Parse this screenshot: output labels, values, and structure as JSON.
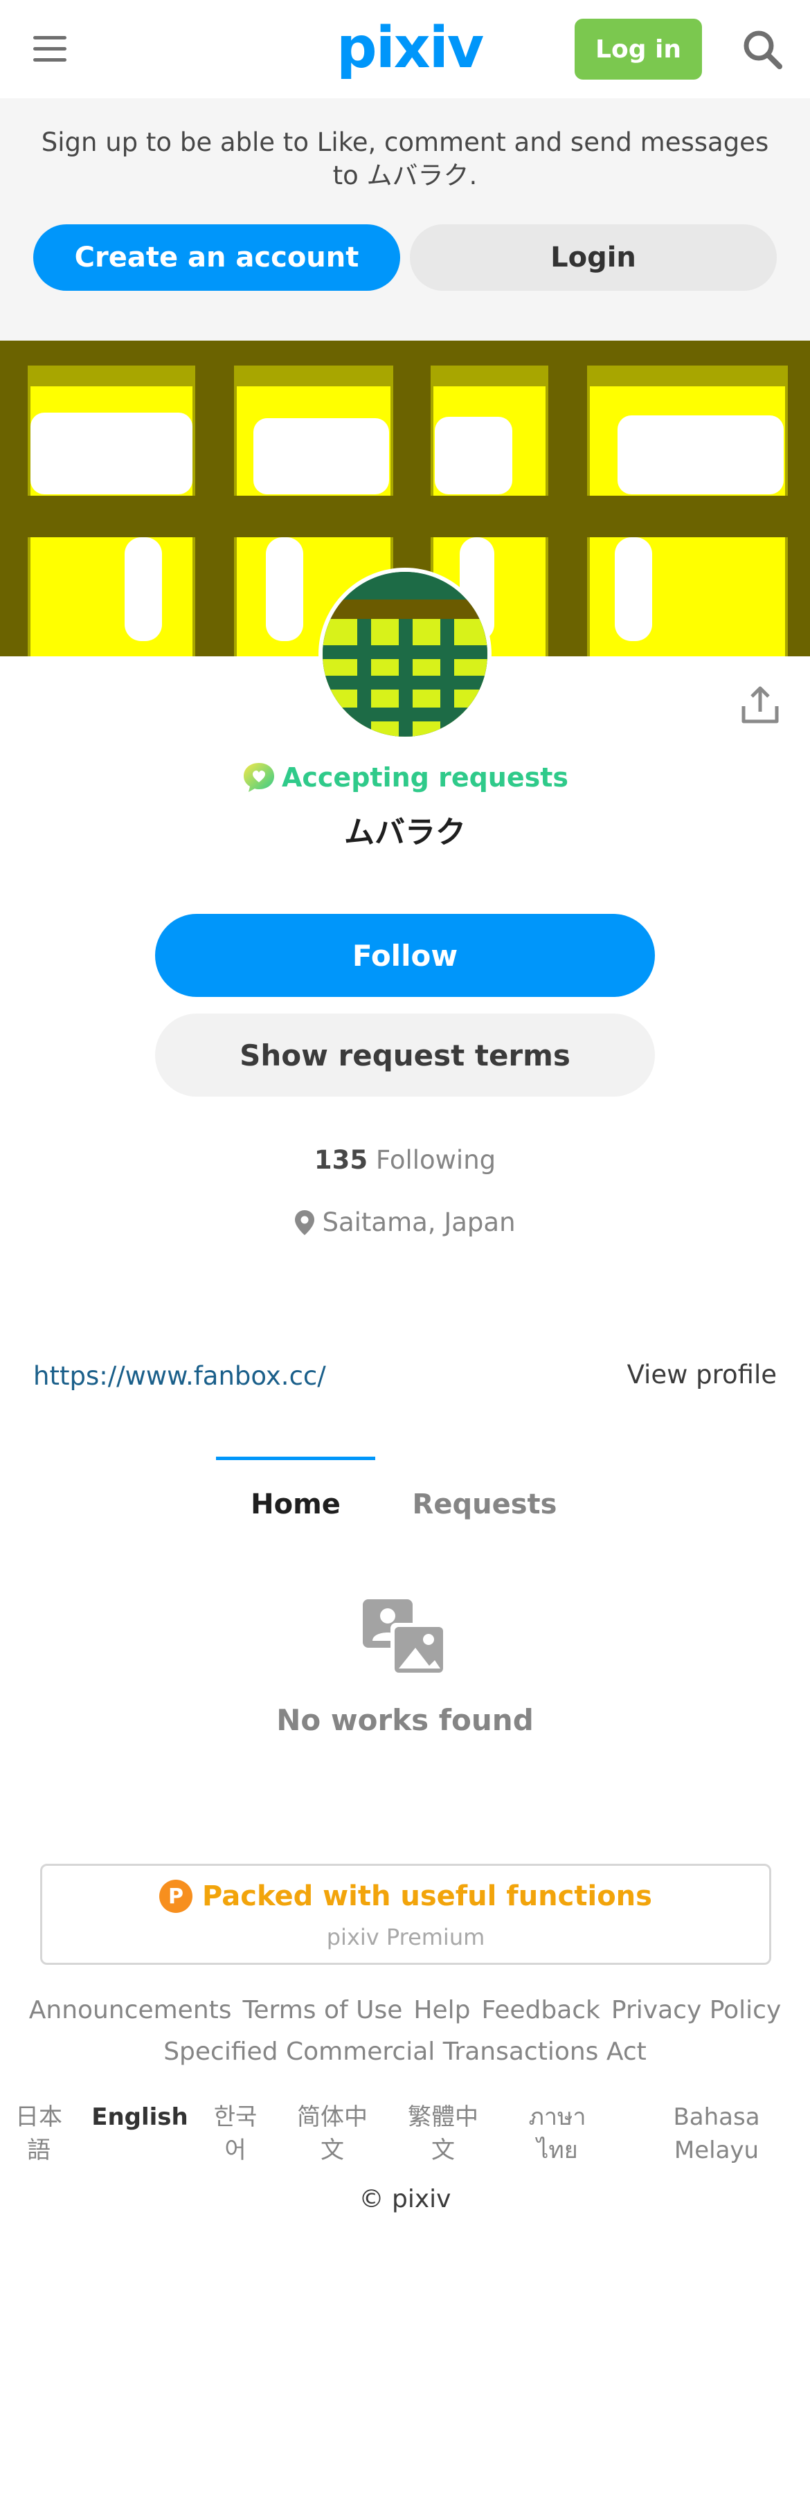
{
  "header": {
    "logo": "pixiv",
    "login_label": "Log in"
  },
  "signup": {
    "message": "Sign up to be able to Like, comment and send messages to ムバラク.",
    "create_account": "Create an account",
    "login": "Login"
  },
  "profile": {
    "accepting_requests": "Accepting requests",
    "name": "ムバラク",
    "follow_label": "Follow",
    "request_terms_label": "Show request terms",
    "following_count": "135",
    "following_label": "Following",
    "location": "Saitama, Japan",
    "link": "https://www.fanbox.cc/",
    "view_profile": "View profile"
  },
  "tabs": [
    {
      "label": "Home",
      "active": true
    },
    {
      "label": "Requests",
      "active": false
    }
  ],
  "empty_state": "No works found",
  "premium": {
    "badge": "P",
    "title": "Packed with useful functions",
    "subtitle": "pixiv Premium"
  },
  "footer": {
    "links": [
      "Announcements",
      "Terms of Use",
      "Help",
      "Feedback",
      "Privacy Policy",
      "Specified Commercial Transactions Act"
    ],
    "languages": [
      "日本語",
      "English",
      "한국어",
      "简体中文",
      "繁體中文",
      "ภาษาไทย",
      "Bahasa Melayu"
    ],
    "active_language": "English",
    "copyright": "© pixiv"
  },
  "colors": {
    "brand": "#0096fa",
    "login_green": "#7bc84f",
    "accepting": "#2fca8a",
    "premium": "#f2a40b"
  }
}
